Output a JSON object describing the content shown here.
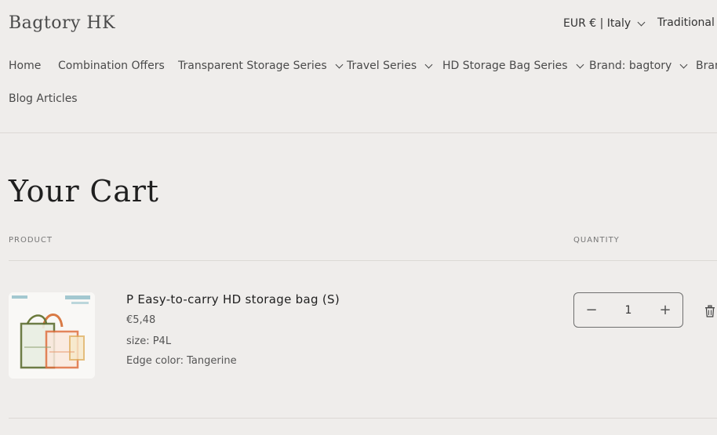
{
  "header": {
    "logo": "Bagtory HK",
    "locale_label": "EUR € | Italy",
    "language_label": "Traditional C"
  },
  "nav": {
    "items": [
      {
        "label": "Home",
        "has_dropdown": false
      },
      {
        "label": "Combination Offers",
        "has_dropdown": false
      },
      {
        "label": "Transparent Storage Series",
        "has_dropdown": true
      },
      {
        "label": "Travel Series",
        "has_dropdown": true
      },
      {
        "label": "HD Storage Bag Series",
        "has_dropdown": true
      },
      {
        "label": "Brand: bagtory",
        "has_dropdown": true
      },
      {
        "label": "Bran",
        "has_dropdown": false
      },
      {
        "label": "Blog Articles",
        "has_dropdown": false
      }
    ]
  },
  "cart": {
    "title": "Your Cart",
    "columns": {
      "product": "PRODUCT",
      "quantity": "QUANTITY"
    },
    "items": [
      {
        "name": "P Easy-to-carry HD storage bag (S)",
        "price": "€5,48",
        "size": "size: P4L",
        "edge_color": "Edge color: Tangerine",
        "quantity": "1",
        "decrease_symbol": "−",
        "increase_symbol": "+"
      }
    ]
  },
  "icons": {
    "chevron": "chevron-down-icon",
    "trash": "trash-icon"
  },
  "colors": {
    "background": "#efedeb",
    "text": "#3a3a3a",
    "divider": "#dcd9d5"
  }
}
